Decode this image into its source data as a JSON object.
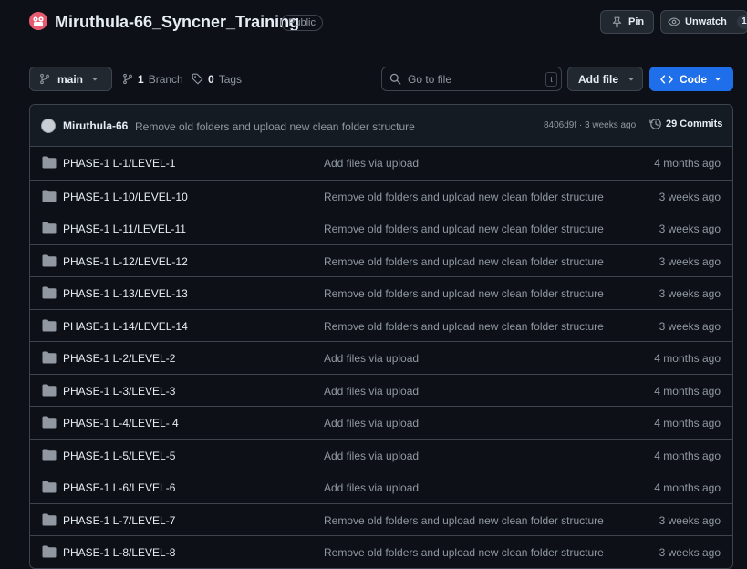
{
  "repo": {
    "name": "Miruthula-66_Syncner_Training",
    "visibility": "Public",
    "pin_label": "Pin",
    "watch_label": "Unwatch",
    "watch_count": "1"
  },
  "toolbar": {
    "branch": "main",
    "branch_count": "1",
    "branch_label": "Branch",
    "tag_count": "0",
    "tag_label": "Tags",
    "search_placeholder": "Go to file",
    "search_shortcut": "t",
    "add_file_label": "Add file",
    "code_label": "Code"
  },
  "latest_commit": {
    "author": "Miruthula-66",
    "message": "Remove old folders and upload new clean folder structure",
    "meta": "8406d9f · 3 weeks ago",
    "commits_label": "29 Commits"
  },
  "files": [
    {
      "name": "PHASE-1 L-1/LEVEL-1",
      "commit": "Add files via upload",
      "age": "4 months ago"
    },
    {
      "name": "PHASE-1 L-10/LEVEL-10",
      "commit": "Remove old folders and upload new clean folder structure",
      "age": "3 weeks ago"
    },
    {
      "name": "PHASE-1 L-11/LEVEL-11",
      "commit": "Remove old folders and upload new clean folder structure",
      "age": "3 weeks ago"
    },
    {
      "name": "PHASE-1 L-12/LEVEL-12",
      "commit": "Remove old folders and upload new clean folder structure",
      "age": "3 weeks ago"
    },
    {
      "name": "PHASE-1 L-13/LEVEL-13",
      "commit": "Remove old folders and upload new clean folder structure",
      "age": "3 weeks ago"
    },
    {
      "name": "PHASE-1 L-14/LEVEL-14",
      "commit": "Remove old folders and upload new clean folder structure",
      "age": "3 weeks ago"
    },
    {
      "name": "PHASE-1 L-2/LEVEL-2",
      "commit": "Add files via upload",
      "age": "4 months ago"
    },
    {
      "name": "PHASE-1 L-3/LEVEL-3",
      "commit": "Add files via upload",
      "age": "4 months ago"
    },
    {
      "name": "PHASE-1 L-4/LEVEL- 4",
      "commit": "Add files via upload",
      "age": "4 months ago"
    },
    {
      "name": "PHASE-1 L-5/LEVEL-5",
      "commit": "Add files via upload",
      "age": "4 months ago"
    },
    {
      "name": "PHASE-1 L-6/LEVEL-6",
      "commit": "Add files via upload",
      "age": "4 months ago"
    },
    {
      "name": "PHASE-1 L-7/LEVEL-7",
      "commit": "Remove old folders and upload new clean folder structure",
      "age": "3 weeks ago"
    },
    {
      "name": "PHASE-1 L-8/LEVEL-8",
      "commit": "Remove old folders and upload new clean folder structure",
      "age": "3 weeks ago"
    }
  ],
  "icons": {
    "repo_avatar": "owner-avatar-icon",
    "pin": "pin-icon",
    "watch": "eye-icon",
    "branch": "git-branch-icon",
    "tag": "tag-icon",
    "search": "search-icon",
    "code": "code-icon",
    "history": "history-icon",
    "folder": "folder-icon"
  },
  "colors": {
    "background": "#0d1117",
    "accent": "#1f6feb",
    "border": "#3d444d",
    "muted_text": "#9198a1",
    "avatar": "#e85a70"
  }
}
